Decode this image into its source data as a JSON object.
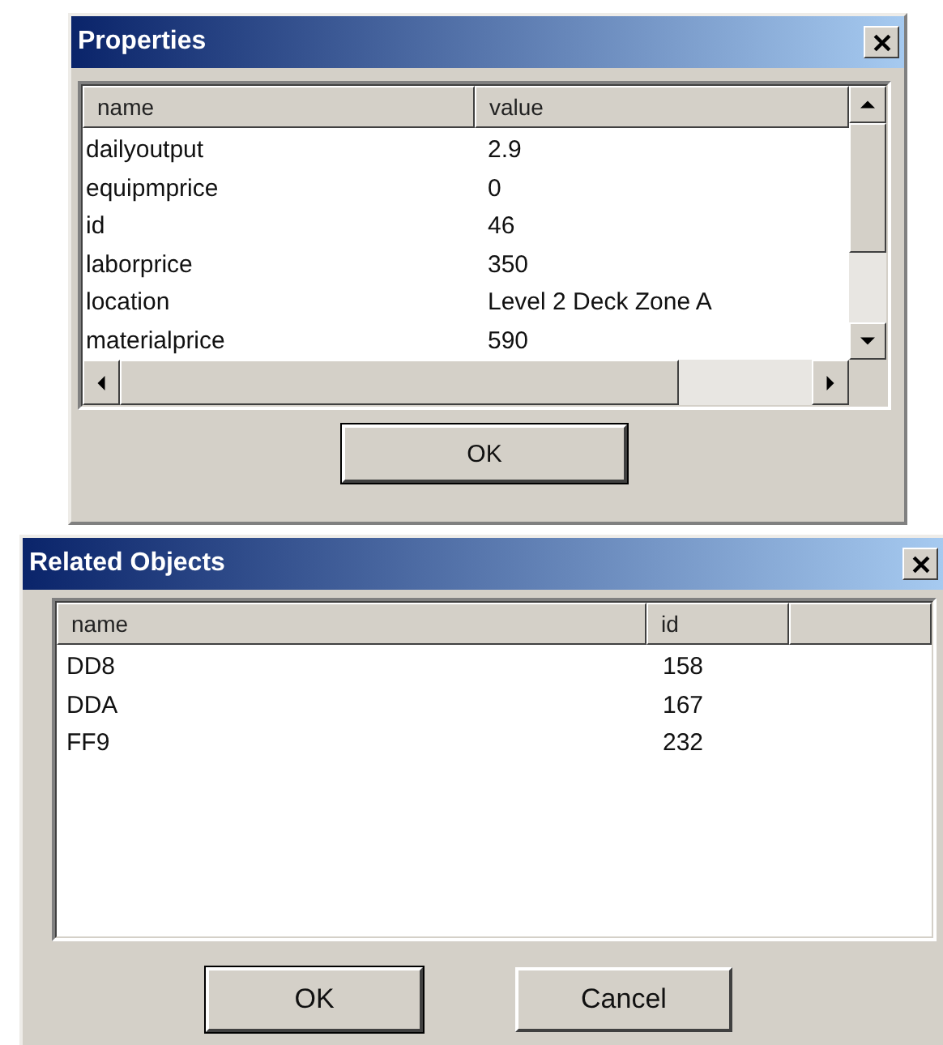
{
  "windows": [
    {
      "kind": "property-sheet",
      "title": "Properties",
      "columns": [
        "name",
        "value"
      ],
      "rows": [
        [
          "dailyoutput",
          "2.9"
        ],
        [
          "equipmprice",
          "0"
        ],
        [
          "id",
          "46"
        ],
        [
          "laborprice",
          "350"
        ],
        [
          "location",
          "Level 2 Deck Zone A"
        ],
        [
          "materialprice",
          "590"
        ]
      ],
      "buttons": [
        "OK"
      ]
    },
    {
      "kind": "object-list",
      "title": "Related Objects",
      "columns": [
        "name",
        "id"
      ],
      "rows": [
        [
          "DD8",
          "158"
        ],
        [
          "DDA",
          "167"
        ],
        [
          "FF9",
          "232"
        ]
      ],
      "buttons": [
        "OK",
        "Cancel"
      ]
    }
  ]
}
